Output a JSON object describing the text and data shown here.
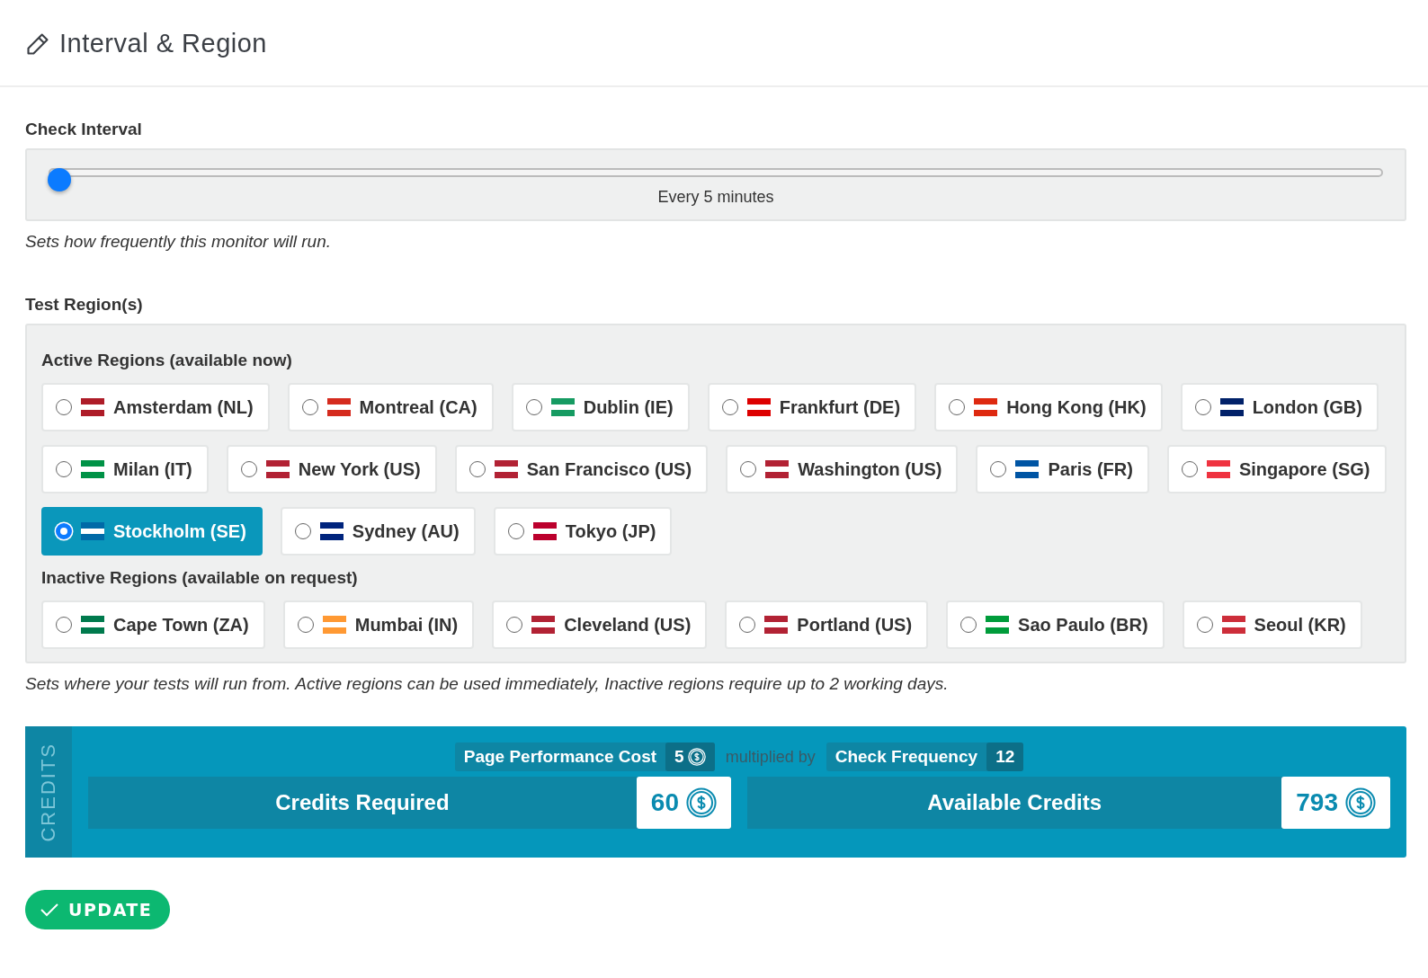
{
  "header": {
    "title": "Interval & Region"
  },
  "interval": {
    "label": "Check Interval",
    "level": 0,
    "reading": "Every 5 minutes",
    "help": "Sets how frequently this monitor will run."
  },
  "regions": {
    "label": "Test Region(s)",
    "groups": [
      {
        "title": "Active Regions (available now)",
        "items": [
          {
            "label": "Amsterdam (NL)",
            "selected": false,
            "color": "#ae1c28"
          },
          {
            "label": "Montreal (CA)",
            "selected": false,
            "color": "#d52b1e"
          },
          {
            "label": "Dublin (IE)",
            "selected": false,
            "color": "#169b62"
          },
          {
            "label": "Frankfurt (DE)",
            "selected": false,
            "color": "#dd0000"
          },
          {
            "label": "Hong Kong (HK)",
            "selected": false,
            "color": "#de2910"
          },
          {
            "label": "London (GB)",
            "selected": false,
            "color": "#012169"
          },
          {
            "label": "Milan (IT)",
            "selected": false,
            "color": "#009246"
          },
          {
            "label": "New York (US)",
            "selected": false,
            "color": "#b22234"
          },
          {
            "label": "San Francisco (US)",
            "selected": false,
            "color": "#b22234"
          },
          {
            "label": "Washington (US)",
            "selected": false,
            "color": "#b22234"
          },
          {
            "label": "Paris (FR)",
            "selected": false,
            "color": "#0055a4"
          },
          {
            "label": "Singapore (SG)",
            "selected": false,
            "color": "#ef3340"
          },
          {
            "label": "Stockholm (SE)",
            "selected": true,
            "color": "#006aa7"
          },
          {
            "label": "Sydney (AU)",
            "selected": false,
            "color": "#00247d"
          },
          {
            "label": "Tokyo (JP)",
            "selected": false,
            "color": "#bc002d"
          }
        ]
      },
      {
        "title": "Inactive Regions (available on request)",
        "items": [
          {
            "label": "Cape Town (ZA)",
            "selected": false,
            "color": "#007a4d"
          },
          {
            "label": "Mumbai (IN)",
            "selected": false,
            "color": "#ff9933"
          },
          {
            "label": "Cleveland (US)",
            "selected": false,
            "color": "#b22234"
          },
          {
            "label": "Portland (US)",
            "selected": false,
            "color": "#b22234"
          },
          {
            "label": "Sao Paulo (BR)",
            "selected": false,
            "color": "#009c3b"
          },
          {
            "label": "Seoul (KR)",
            "selected": false,
            "color": "#cd2e3a"
          }
        ]
      }
    ],
    "help": "Sets where your tests will run from. Active regions can be used immediately, Inactive regions require up to 2 working days."
  },
  "credits": {
    "side_label": "CREDITS",
    "cost_label": "Page Performance Cost",
    "cost_value": "5",
    "multiplier": "multiplied by",
    "frequency_label": "Check Frequency",
    "frequency_value": "12",
    "required_label": "Credits Required",
    "required_value": "60",
    "available_label": "Available Credits",
    "available_value": "793"
  },
  "update_button": "UPDATE"
}
